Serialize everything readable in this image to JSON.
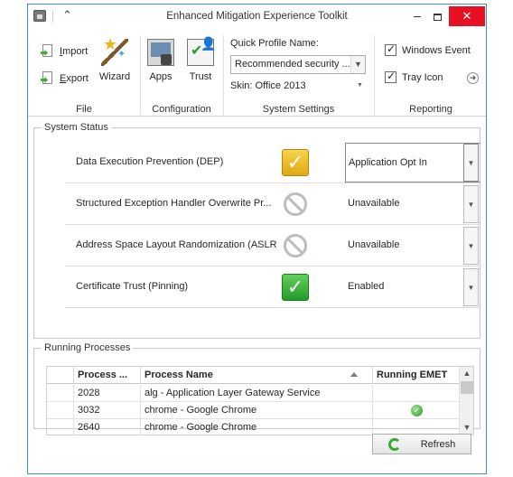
{
  "window": {
    "title": "Enhanced Mitigation Experience Toolkit",
    "close_glyph": "✕",
    "collapse_glyph": "⌃"
  },
  "ribbon": {
    "file": {
      "label": "File",
      "import_prefix": "",
      "import_underlined": "I",
      "import_rest": "mport",
      "export_prefix": "",
      "export_underlined": "E",
      "export_rest": "xport",
      "wizard_label": "Wizard"
    },
    "configuration": {
      "label": "Configuration",
      "apps_label": "Apps",
      "trust_label": "Trust"
    },
    "system_settings": {
      "label": "System Settings",
      "quick_profile_label": "Quick Profile Name:",
      "quick_profile_value": "Recommended security ...",
      "skin_label": "Skin: Office 2013"
    },
    "reporting": {
      "label": "Reporting",
      "windows_event_label": "Windows Event",
      "tray_icon_label": "Tray Icon",
      "windows_event_checked": true,
      "tray_icon_checked": true
    }
  },
  "system_status": {
    "legend": "System Status",
    "rows": [
      {
        "name": "Data Execution Prevention (DEP)",
        "icon": "check-yellow-icon",
        "value": "Application Opt In"
      },
      {
        "name": "Structured Exception Handler Overwrite Pr...",
        "icon": "disabled-icon",
        "value": "Unavailable"
      },
      {
        "name": "Address Space Layout Randomization (ASLR)",
        "icon": "disabled-icon",
        "value": "Unavailable"
      },
      {
        "name": "Certificate Trust (Pinning)",
        "icon": "check-green-icon",
        "value": "Enabled"
      }
    ]
  },
  "running_processes": {
    "legend": "Running Processes",
    "columns": [
      "Process ...",
      "Process Name",
      "Running EMET"
    ],
    "rows": [
      {
        "pid": "2028",
        "name": "alg - Application Layer Gateway Service",
        "emet": false
      },
      {
        "pid": "3032",
        "name": "chrome - Google Chrome",
        "emet": true
      },
      {
        "pid": "2640",
        "name": "chrome - Google Chrome",
        "emet": false
      }
    ]
  },
  "refresh_label": "Refresh",
  "colors": {
    "window_border": "#3a8fd6",
    "close_button": "#e81123",
    "ok_green": "#2a9d2a",
    "warn_yellow": "#e0a915"
  }
}
